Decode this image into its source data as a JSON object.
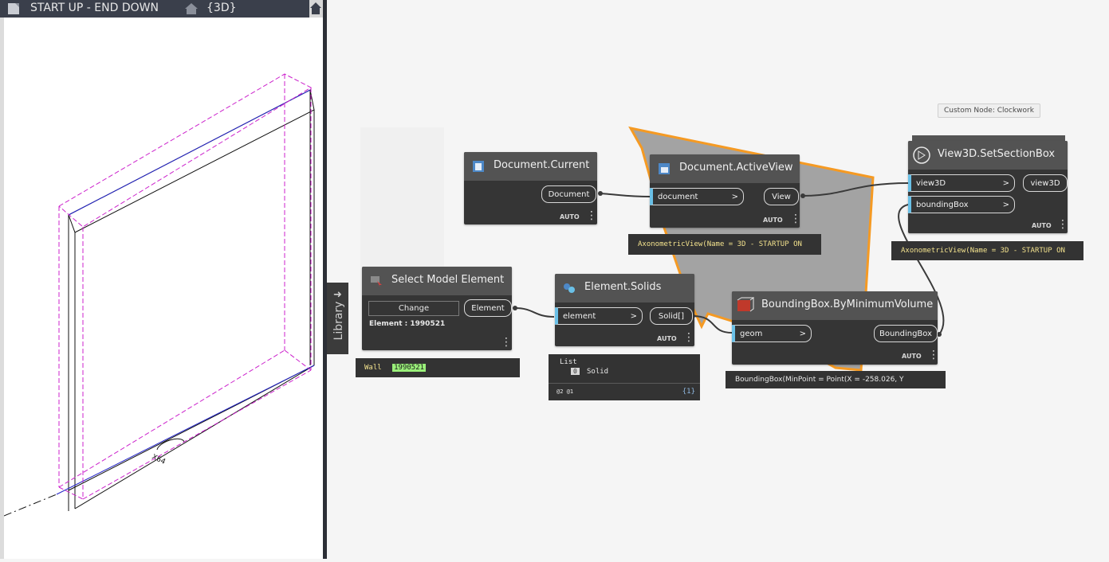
{
  "view": {
    "tab_title": "START UP - END DOWN",
    "view_name": "{3D}",
    "model_tag": "Wall"
  },
  "library": {
    "label": "Library"
  },
  "nodes": {
    "document_current": {
      "title": "Document.Current",
      "output": "Document",
      "mode": "AUTO"
    },
    "document_activeview": {
      "title": "Document.ActiveView",
      "input": "document",
      "output": "View",
      "mode": "AUTO",
      "preview": "AxonometricView(Name = 3D - STARTUP ON"
    },
    "select_model_element": {
      "title": "Select Model Element",
      "button": "Change",
      "output": "Element",
      "element_label": "Element : 1990521",
      "preview_label": "Wall",
      "preview_value": "1990521"
    },
    "element_solids": {
      "title": "Element.Solids",
      "input": "element",
      "output": "Solid[]",
      "mode": "AUTO",
      "preview_list": "List",
      "preview_index": "0",
      "preview_item": "Solid",
      "preview_footer_left": "@2 @1",
      "preview_footer_right": "{1}"
    },
    "boundingbox": {
      "title": "BoundingBox.ByMinimumVolume",
      "input": "geom",
      "output": "BoundingBox",
      "mode": "AUTO",
      "preview": "BoundingBox(MinPoint = Point(X = -258.026, Y"
    },
    "setsectionbox": {
      "title": "View3D.SetSectionBox",
      "input_1": "view3D",
      "input_2": "boundingBox",
      "output": "view3D",
      "mode": "AUTO",
      "preview": "AxonometricView(Name = 3D - STARTUP ON",
      "tooltip": "Custom Node: Clockwork"
    }
  },
  "colors": {
    "port_accent": "#6ac0e7",
    "preview_text": "#f3e28d",
    "group_orange": "#f59a23",
    "value_highlight": "#9af07a"
  }
}
